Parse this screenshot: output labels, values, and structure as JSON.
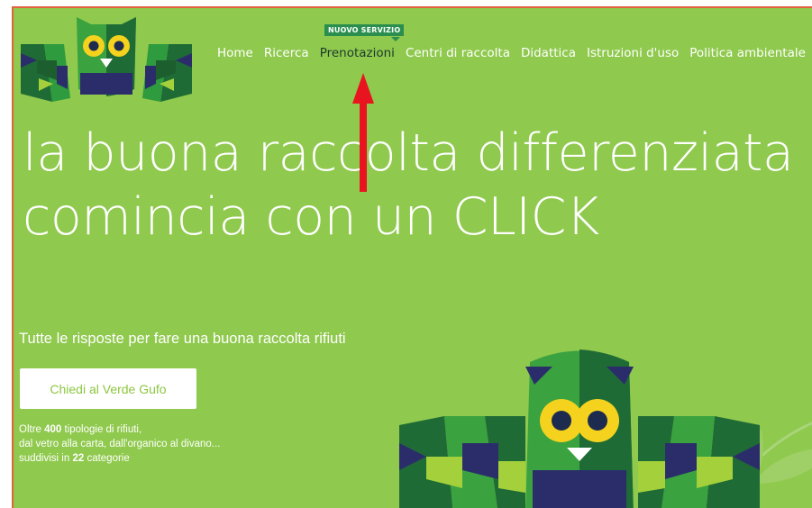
{
  "nav": {
    "badge": "NUOVO SERVIZIO",
    "items": [
      {
        "label": "Home"
      },
      {
        "label": "Ricerca"
      },
      {
        "label": "Prenotazioni"
      },
      {
        "label": "Centri di raccolta"
      },
      {
        "label": "Didattica"
      },
      {
        "label": "Istruzioni d'uso"
      },
      {
        "label": "Politica ambientale"
      }
    ]
  },
  "hero": {
    "line1": "la buona raccolta differenziata",
    "line2": "comincia con un CLICK",
    "subtitle": "Tutte le risposte per fare una buona raccolta rifiuti",
    "cta_label": "Chiedi al Verde Gufo",
    "info": {
      "l1_pre": "Oltre ",
      "l1_num": "400",
      "l1_post": " tipologie di rifiuti,",
      "l2": "dal vetro alla carta, dall'organico al divano...",
      "l3_pre": "suddivisi in ",
      "l3_num": "22",
      "l3_post": " categorie"
    }
  },
  "colors": {
    "background": "#8fc94d",
    "frame_border": "#e2623f",
    "annotation_arrow": "#e8141f",
    "badge": "#2a8f4e"
  },
  "icons": [
    "owl-logo-icon",
    "owl-mascot-icon",
    "leaf-icon",
    "red-arrow-annotation"
  ]
}
